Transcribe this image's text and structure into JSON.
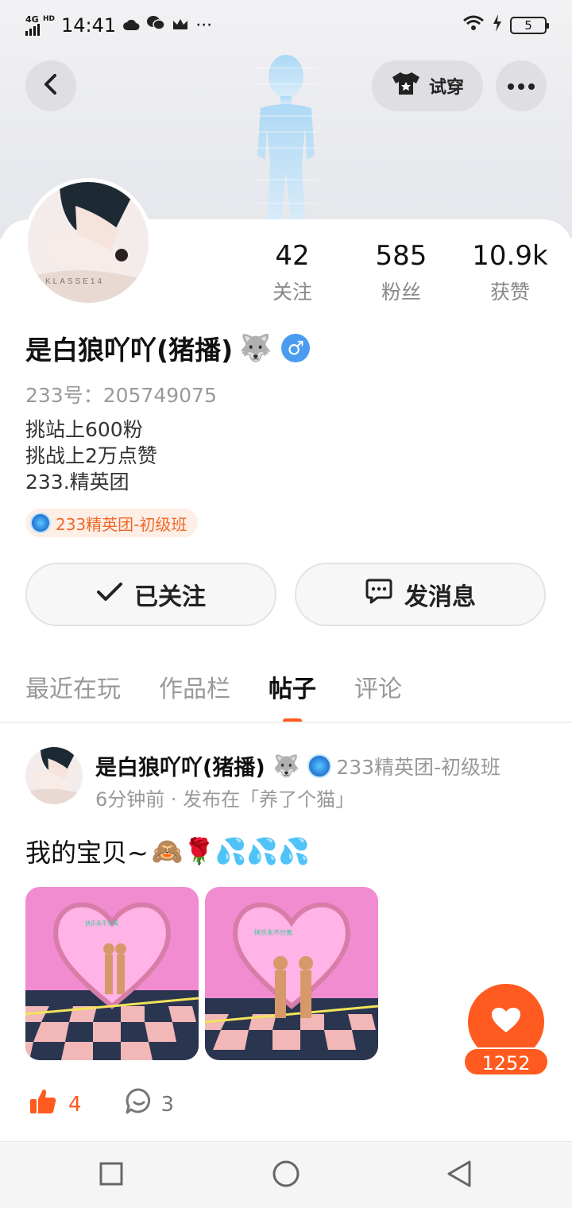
{
  "status_bar": {
    "network": "4G",
    "network_sup": "HD",
    "time": "14:41",
    "more": "···",
    "battery": "5"
  },
  "top": {
    "tryon_label": "试穿"
  },
  "profile": {
    "stats": [
      {
        "value": "42",
        "label": "关注"
      },
      {
        "value": "585",
        "label": "粉丝"
      },
      {
        "value": "10.9k",
        "label": "获赞"
      }
    ],
    "name": "是白狼吖吖(猪播)",
    "name_emoji": "🐺",
    "gender": "♂",
    "id_line": "233号：205749075",
    "bio": [
      "挑站上600粉",
      "挑战上2万点赞",
      "233.精英团"
    ],
    "badge": "233精英团-初级班"
  },
  "actions": {
    "follow_label": "已关注",
    "message_label": "发消息"
  },
  "tabs": [
    {
      "label": "最近在玩",
      "active": false
    },
    {
      "label": "作品栏",
      "active": false
    },
    {
      "label": "帖子",
      "active": true
    },
    {
      "label": "评论",
      "active": false
    }
  ],
  "post": {
    "author": "是白狼吖吖(猪播)",
    "author_emoji": "🐺",
    "author_tag": "233精英团-初级班",
    "meta": "6分钟前 · 发布在「养了个猫」",
    "text": "我的宝贝~",
    "text_emojis": "🙈🌹💦💦💦",
    "likes": "4",
    "comments": "3"
  },
  "fab": {
    "count": "1252"
  },
  "colors": {
    "accent": "#ff5a1f",
    "badge_text": "#ef6a2a",
    "gender_blue": "#4a9cf0"
  }
}
